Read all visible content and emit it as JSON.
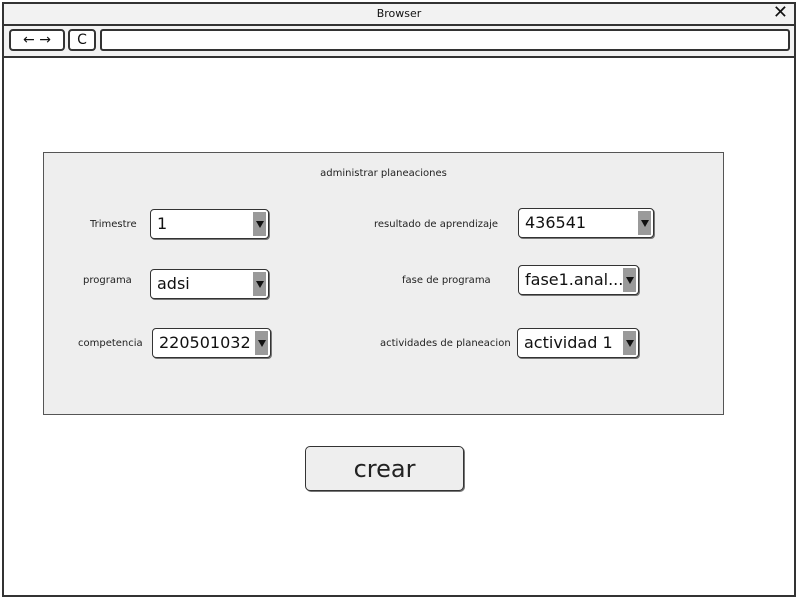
{
  "browser": {
    "title": "Browser",
    "close_glyph": "✕",
    "nav_glyph": "← →",
    "refresh_glyph": "C",
    "url": ""
  },
  "form": {
    "title": "administrar planeaciones",
    "fields": {
      "trimestre": {
        "label": "Trimestre",
        "value": "1"
      },
      "programa": {
        "label": "programa",
        "value": "adsi"
      },
      "competencia": {
        "label": "competencia",
        "value": "220501032"
      },
      "resultado": {
        "label": "resultado de aprendizaje",
        "value": "436541"
      },
      "fase": {
        "label": "fase de programa",
        "value": "fase1.anal..."
      },
      "actividades": {
        "label": "actividades de planeacion",
        "value": "actividad 1"
      }
    },
    "submit_label": "crear"
  },
  "icons": [
    "close-icon",
    "back-forward-icon",
    "refresh-icon",
    "dropdown-arrow-icon"
  ]
}
